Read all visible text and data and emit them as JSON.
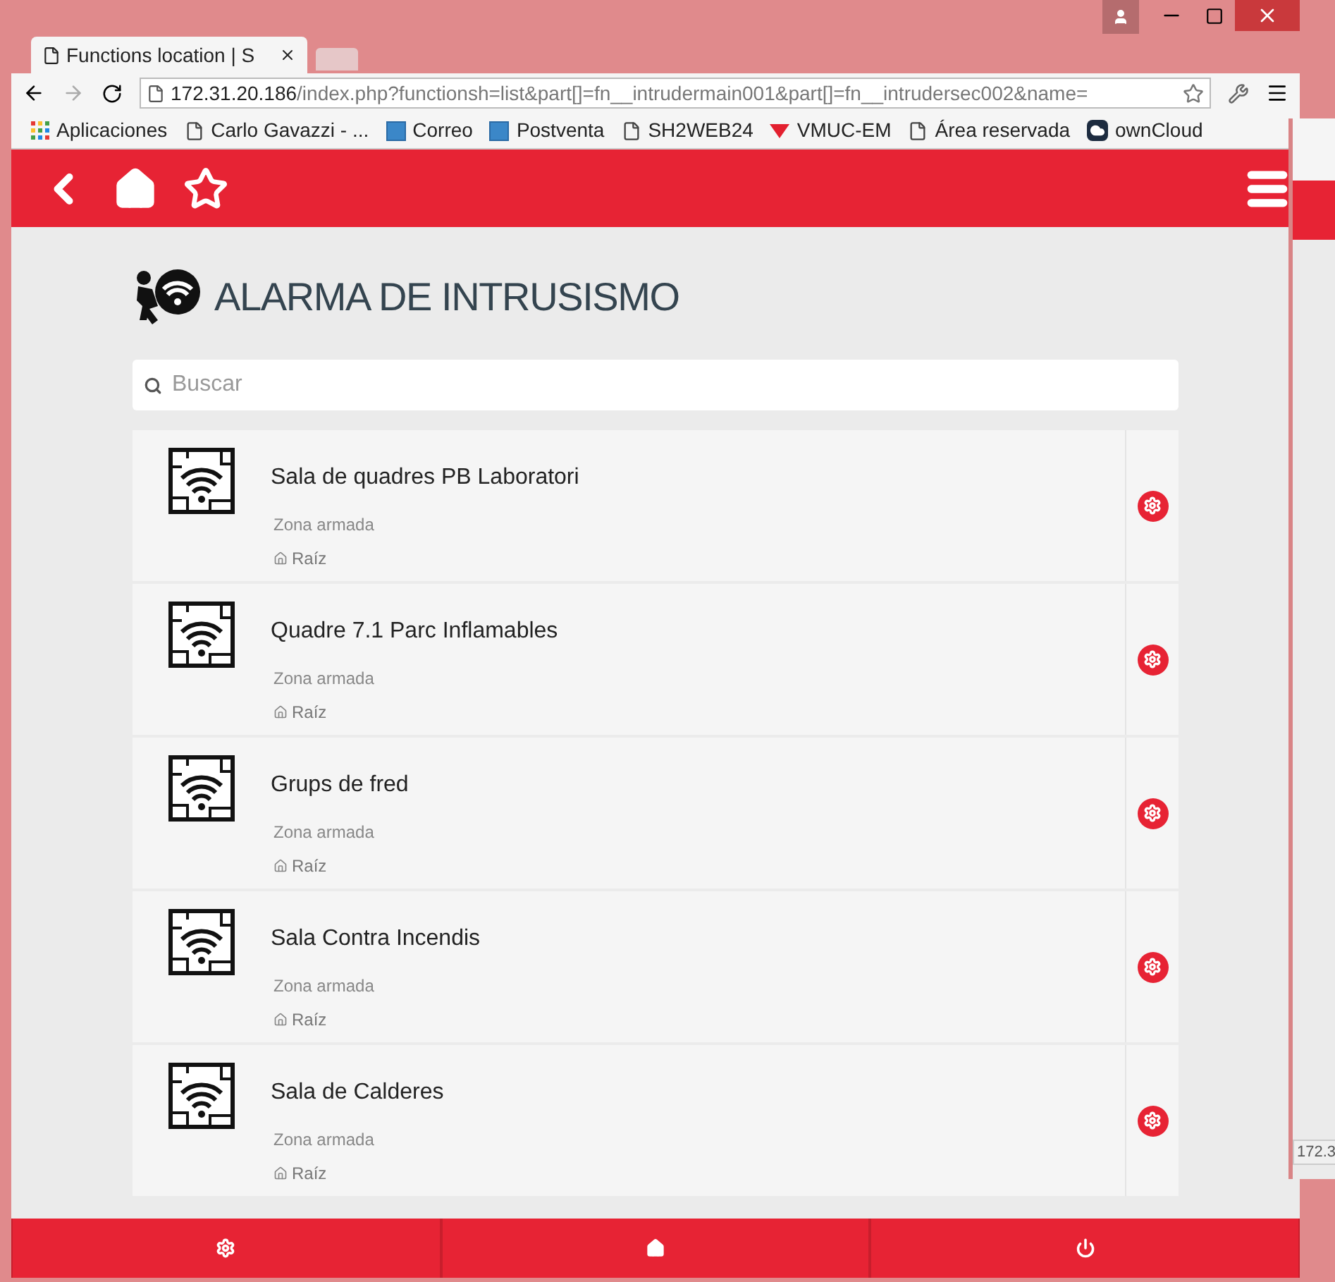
{
  "browser": {
    "tab_title": "Functions location | S",
    "url_host": "172.31.20.186",
    "url_path": "/index.php?functionsh=list&part[]=fn__intrudermain001&part[]=fn__intrudersec002&name=",
    "bookmarks": [
      {
        "kind": "apps",
        "label": "Aplicaciones"
      },
      {
        "kind": "page",
        "label": "Carlo Gavazzi - ..."
      },
      {
        "kind": "site",
        "label": "Correo"
      },
      {
        "kind": "site",
        "label": "Postventa"
      },
      {
        "kind": "page",
        "label": "SH2WEB24"
      },
      {
        "kind": "flag",
        "label": "VMUC-EM"
      },
      {
        "kind": "page",
        "label": "Área reservada"
      },
      {
        "kind": "cloud",
        "label": "ownCloud"
      }
    ]
  },
  "background_window": {
    "status_text": "172.3"
  },
  "page": {
    "title": "ALARMA DE INTRUSISMO",
    "search": {
      "placeholder": "Buscar"
    },
    "zones": [
      {
        "name": "Sala de quadres PB Laboratori",
        "status": "Zona armada",
        "location": "Raíz"
      },
      {
        "name": "Quadre 7.1 Parc Inflamables",
        "status": "Zona armada",
        "location": "Raíz"
      },
      {
        "name": "Grups de fred",
        "status": "Zona armada",
        "location": "Raíz"
      },
      {
        "name": "Sala Contra Incendis",
        "status": "Zona armada",
        "location": "Raíz"
      },
      {
        "name": "Sala de Calderes",
        "status": "Zona armada",
        "location": "Raíz"
      }
    ]
  },
  "footer": {
    "buttons": [
      {
        "kind": "settings"
      },
      {
        "kind": "home"
      },
      {
        "kind": "power"
      }
    ]
  }
}
